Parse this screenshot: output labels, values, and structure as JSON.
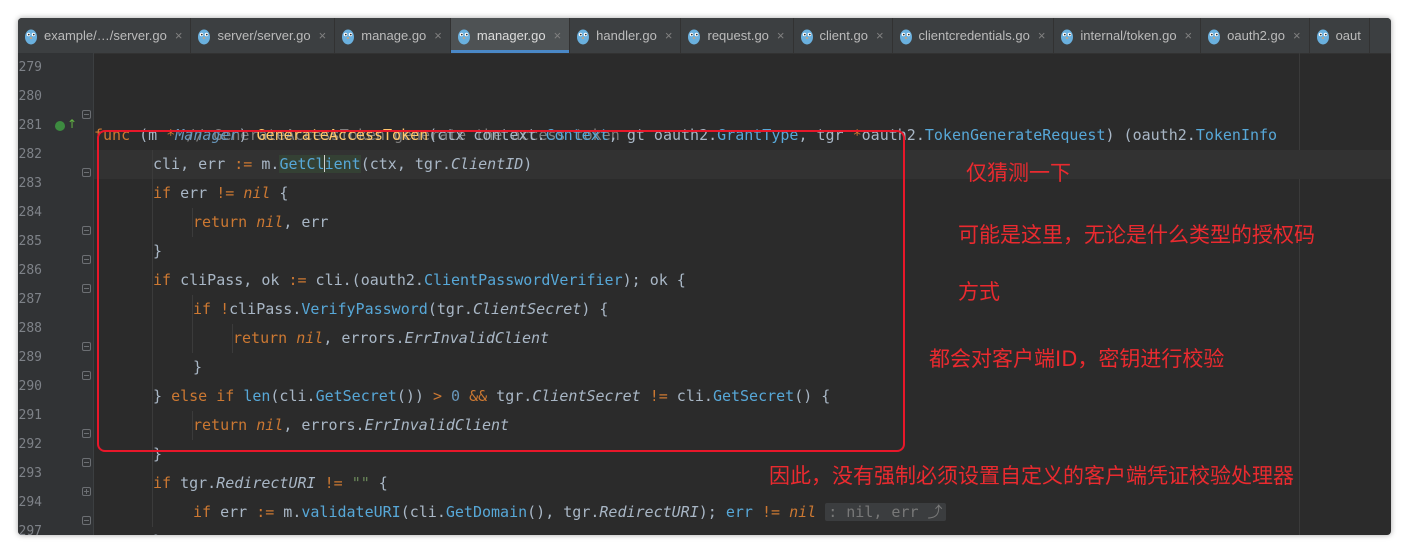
{
  "tabs": [
    {
      "label": "example/…/server.go",
      "active": false
    },
    {
      "label": "server/server.go",
      "active": false
    },
    {
      "label": "manage.go",
      "active": false
    },
    {
      "label": "manager.go",
      "active": true
    },
    {
      "label": "handler.go",
      "active": false
    },
    {
      "label": "request.go",
      "active": false
    },
    {
      "label": "client.go",
      "active": false
    },
    {
      "label": "clientcredentials.go",
      "active": false
    },
    {
      "label": "internal/token.go",
      "active": false
    },
    {
      "label": "oauth2.go",
      "active": false
    },
    {
      "label": "oaut",
      "active": false
    }
  ],
  "tab_close_glyph": "×",
  "line_numbers": [
    "279",
    "280",
    "281",
    "282",
    "283",
    "284",
    "285",
    "286",
    "287",
    "288",
    "289",
    "290",
    "291",
    "292",
    "293",
    "294",
    "297"
  ],
  "code": {
    "l280": {
      "comment": "// GenerateAccessToken generate the access token"
    },
    "l281": {
      "func": "func",
      "open": " (m ",
      "ptr": "*",
      "recv": "Manager",
      "close": ") ",
      "name": "GenerateAccessToken",
      "params1": "(ctx context.",
      "ctxType": "Context",
      "params2": ", gt oauth2.",
      "gtType": "GrantType",
      "params3": ", tgr ",
      "ptr2": "*",
      "params4": "oauth2.",
      "reqType": "TokenGenerateRequest",
      "params5": ") (oauth2.",
      "retType": "TokenInfo"
    },
    "l282": {
      "a": "cli, err ",
      "op": ":=",
      "b": " m.",
      "callA": "GetCl",
      "callB": "ient",
      "c": "(ctx, tgr.",
      "field": "ClientID",
      "d": ")"
    },
    "l283": {
      "kw": "if",
      "a": " err ",
      "op": "!=",
      "b": " ",
      "nil": "nil",
      "c": " {"
    },
    "l284": {
      "kw": "return",
      "b": " ",
      "nil": "nil",
      "c": ", err"
    },
    "l285": {
      "a": "}"
    },
    "l286": {
      "kw": "if",
      "a": " cliPass, ok ",
      "op": ":=",
      "b": " cli.(oauth2.",
      "type": "ClientPasswordVerifier",
      "c": "); ok {"
    },
    "l287": {
      "kw": "if",
      "b": " ",
      "op": "!",
      "a": "cliPass.",
      "call": "VerifyPassword",
      "c": "(tgr.",
      "field": "ClientSecret",
      "d": ") {"
    },
    "l288": {
      "kw": "return",
      "b": " ",
      "nil": "nil",
      "c": ", errors.",
      "err": "ErrInvalidClient"
    },
    "l289": {
      "a": "}"
    },
    "l290": {
      "a": "} ",
      "kw1": "else",
      "b": " ",
      "kw2": "if",
      "c": " ",
      "call1": "len",
      "d": "(cli.",
      "call2": "GetSecret",
      "e": "()) ",
      "op1": ">",
      "f": " ",
      "num": "0",
      "g": " ",
      "op2": "&&",
      "h": " tgr.",
      "field": "ClientSecret",
      "i": " ",
      "op3": "!=",
      "j": " cli.",
      "call3": "GetSecret",
      "k": "() {"
    },
    "l291": {
      "kw": "return",
      "b": " ",
      "nil": "nil",
      "c": ", errors.",
      "err": "ErrInvalidClient"
    },
    "l292": {
      "a": "}"
    },
    "l293": {
      "kw": "if",
      "a": " tgr.",
      "field": "RedirectURI",
      "b": " ",
      "op": "!=",
      "c": " ",
      "str": "\"\"",
      "d": " {"
    },
    "l294": {
      "kw": "if",
      "a": " err ",
      "op": ":=",
      "b": " m.",
      "call1": "validateURI",
      "c": "(cli.",
      "call2": "GetDomain",
      "d": "(), tgr.",
      "field": "RedirectURI",
      "e": "); ",
      "err2": "err",
      "f": " ",
      "op2": "!=",
      "g": " ",
      "nil": "nil",
      "ghost": ": nil, err ⤴"
    },
    "l297": {
      "a": "}"
    }
  },
  "annotations": {
    "a1": "仅猜测一下",
    "a2": "可能是这里，无论是什么类型的授权码",
    "a3": "方式",
    "a4": "都会对客户端ID，密钥进行校验",
    "a5": "因此，没有强制必须设置自定义的客户端凭证校验处理器"
  },
  "colors": {
    "editor_bg": "#2b2b2b",
    "keyword": "#cc7832",
    "function": "#ffc66d",
    "type": "#6897bb",
    "method_call": "#57a8d8",
    "comment": "#808080",
    "string": "#6a8759",
    "annotation_red": "#e8172a"
  }
}
